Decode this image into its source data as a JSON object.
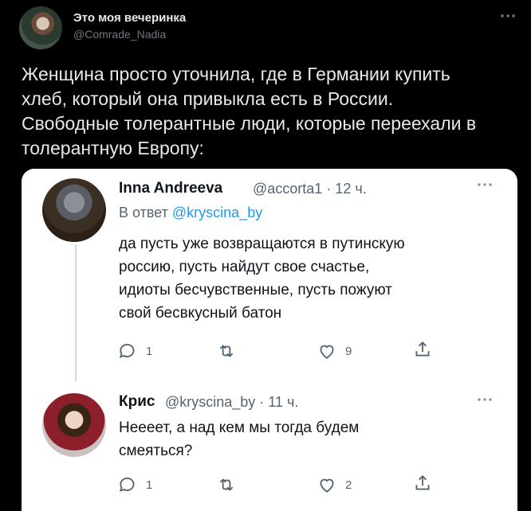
{
  "tweet": {
    "display_name": "Это моя вечеринка",
    "handle": "@Comrade_Nadia",
    "more_icon": "more-horizontal-icon",
    "text_lines": [
      "Женщина просто уточнила, где в Германии купить",
      "хлеб, который она привыкла есть в России.",
      "Свободные толерантные люди, которые переехали в",
      "толерантную Европу:"
    ]
  },
  "screenshot": {
    "replies": [
      {
        "name": "Inna Andreeva",
        "meta": "@accorta1 · 12 ч.",
        "reply_prefix": "В ответ",
        "reply_to": "@kryscina_by",
        "body_lines": [
          "да пусть уже возвращаются в путинскую",
          "россию, пусть найдут свое счастье,",
          "идиоты бесчувственные, пусть пожуют",
          "свой бесвкусный батон"
        ],
        "actions": {
          "replies": "1",
          "retweets": "",
          "likes": "9"
        }
      },
      {
        "name": "Крис",
        "meta": "@kryscina_by · 11 ч.",
        "body_lines": [
          "Неееет, а над кем мы тогда будем",
          "смеяться?"
        ],
        "actions": {
          "replies": "1",
          "retweets": "",
          "likes": "2"
        }
      }
    ]
  },
  "colors": {
    "background": "#000000",
    "card": "#ffffff",
    "link": "#1d9bf0",
    "muted": "#536471"
  }
}
